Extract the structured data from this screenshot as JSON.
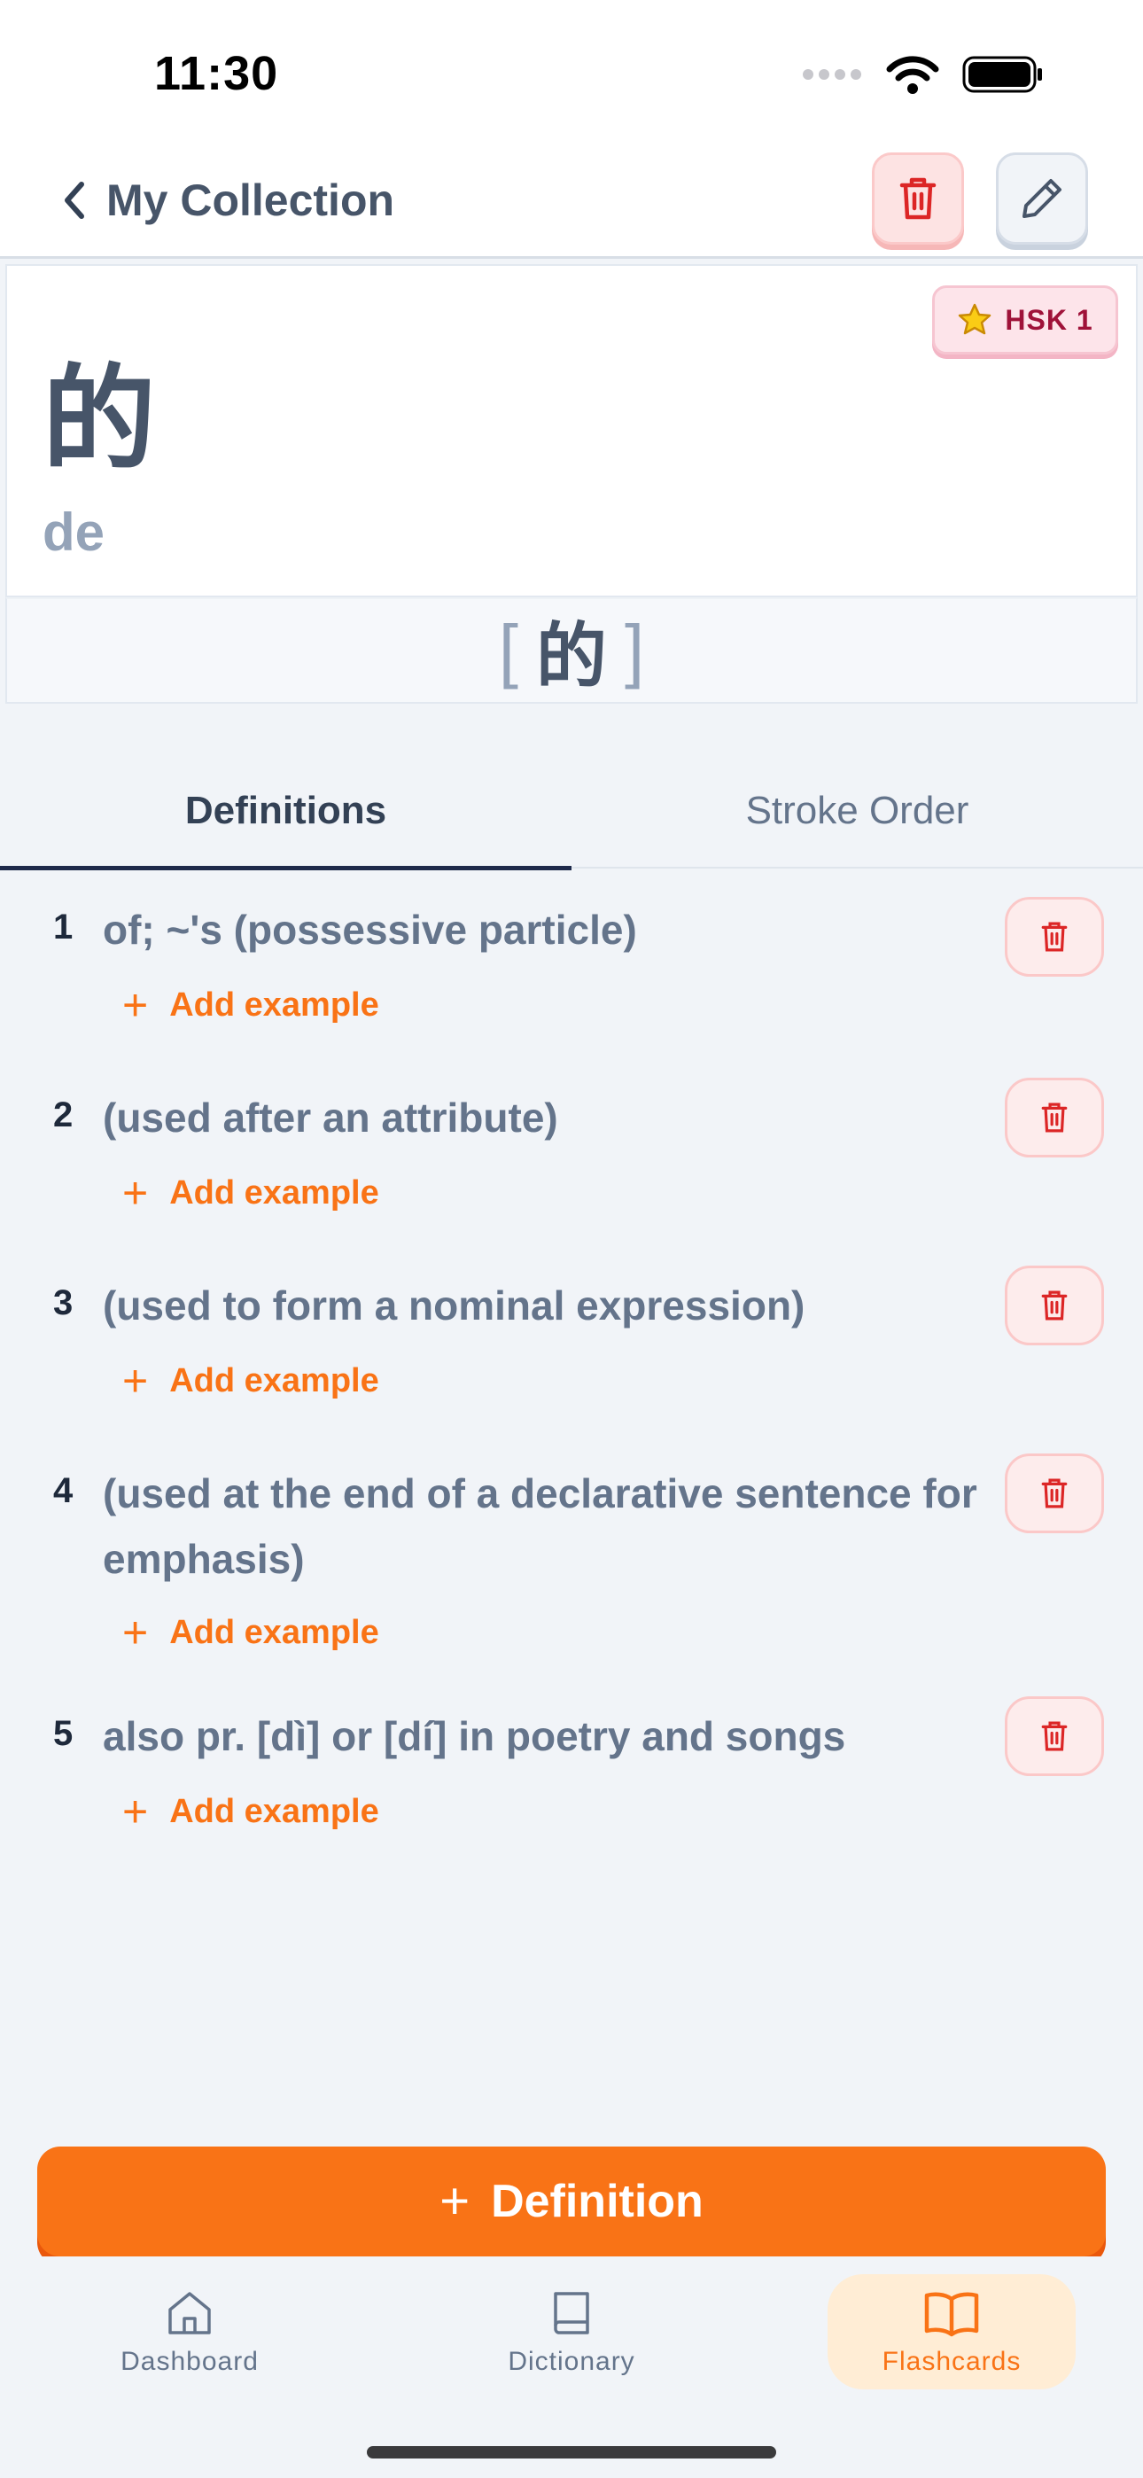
{
  "status_bar": {
    "time": "11:30"
  },
  "nav": {
    "back_label": "My Collection",
    "delete_icon": "trash-icon",
    "edit_icon": "pencil-icon"
  },
  "word": {
    "hsk_level": "HSK 1",
    "hanzi": "的",
    "pinyin": "de",
    "traditional_open": "[",
    "traditional": "的",
    "traditional_close": "]"
  },
  "tabs": [
    {
      "label": "Definitions",
      "active": true
    },
    {
      "label": "Stroke Order",
      "active": false
    }
  ],
  "definitions": [
    {
      "num": "1",
      "text": "of; ~'s (possessive particle)",
      "add_label": "Add example"
    },
    {
      "num": "2",
      "text": "(used after an attribute)",
      "add_label": "Add example"
    },
    {
      "num": "3",
      "text": "(used to form a nominal expression)",
      "add_label": "Add example"
    },
    {
      "num": "4",
      "text": "(used at the end of a declarative sentence for emphasis)",
      "add_label": "Add example"
    },
    {
      "num": "5",
      "text": "also pr. [dì] or [dí] in poetry and songs",
      "add_label": "Add example"
    }
  ],
  "add_definition": {
    "plus": "+",
    "label": "Definition"
  },
  "add_example_plus": "+",
  "tab_bar": [
    {
      "label": "Dashboard",
      "icon": "home-icon",
      "active": false
    },
    {
      "label": "Dictionary",
      "icon": "book-icon",
      "active": false
    },
    {
      "label": "Flashcards",
      "icon": "open-book-icon",
      "active": true
    }
  ],
  "colors": {
    "accent": "#f97316",
    "danger": "#dc2626",
    "text_dark": "#334155",
    "text_muted": "#64748b"
  }
}
